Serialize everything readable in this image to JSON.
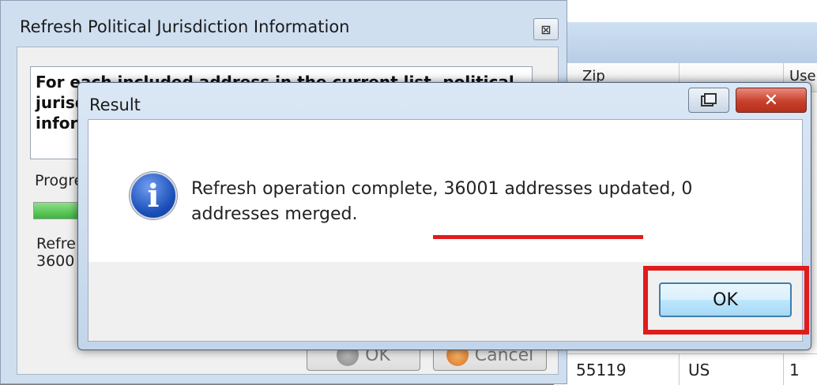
{
  "back_window": {
    "title": "Refresh Political Jurisdiction Information",
    "close_glyph": "⊠",
    "description_visible": "For each included address in the current list, political",
    "description_line2": "jurisd",
    "description_line3": "inform",
    "progress_label": "Progre",
    "progress_percent": 100,
    "status_line1": "Refre",
    "status_line2": "3600",
    "ok_label": "OK",
    "cancel_label": "Cancel"
  },
  "grid": {
    "columns": [
      "Zip",
      "Use"
    ],
    "row": [
      "55119",
      "US",
      "1"
    ]
  },
  "dialog": {
    "title": "Result",
    "icon": "info-icon",
    "icon_glyph": "i",
    "message_before": "Refresh operation complete, ",
    "message_highlight": "36001 addresses updated",
    "message_after": ", 0 addresses merged.",
    "ok_label": "OK",
    "close_glyph": "✕"
  },
  "colors": {
    "annotation_red": "#e11b1b",
    "button_border_focus": "#3c7fb1"
  }
}
